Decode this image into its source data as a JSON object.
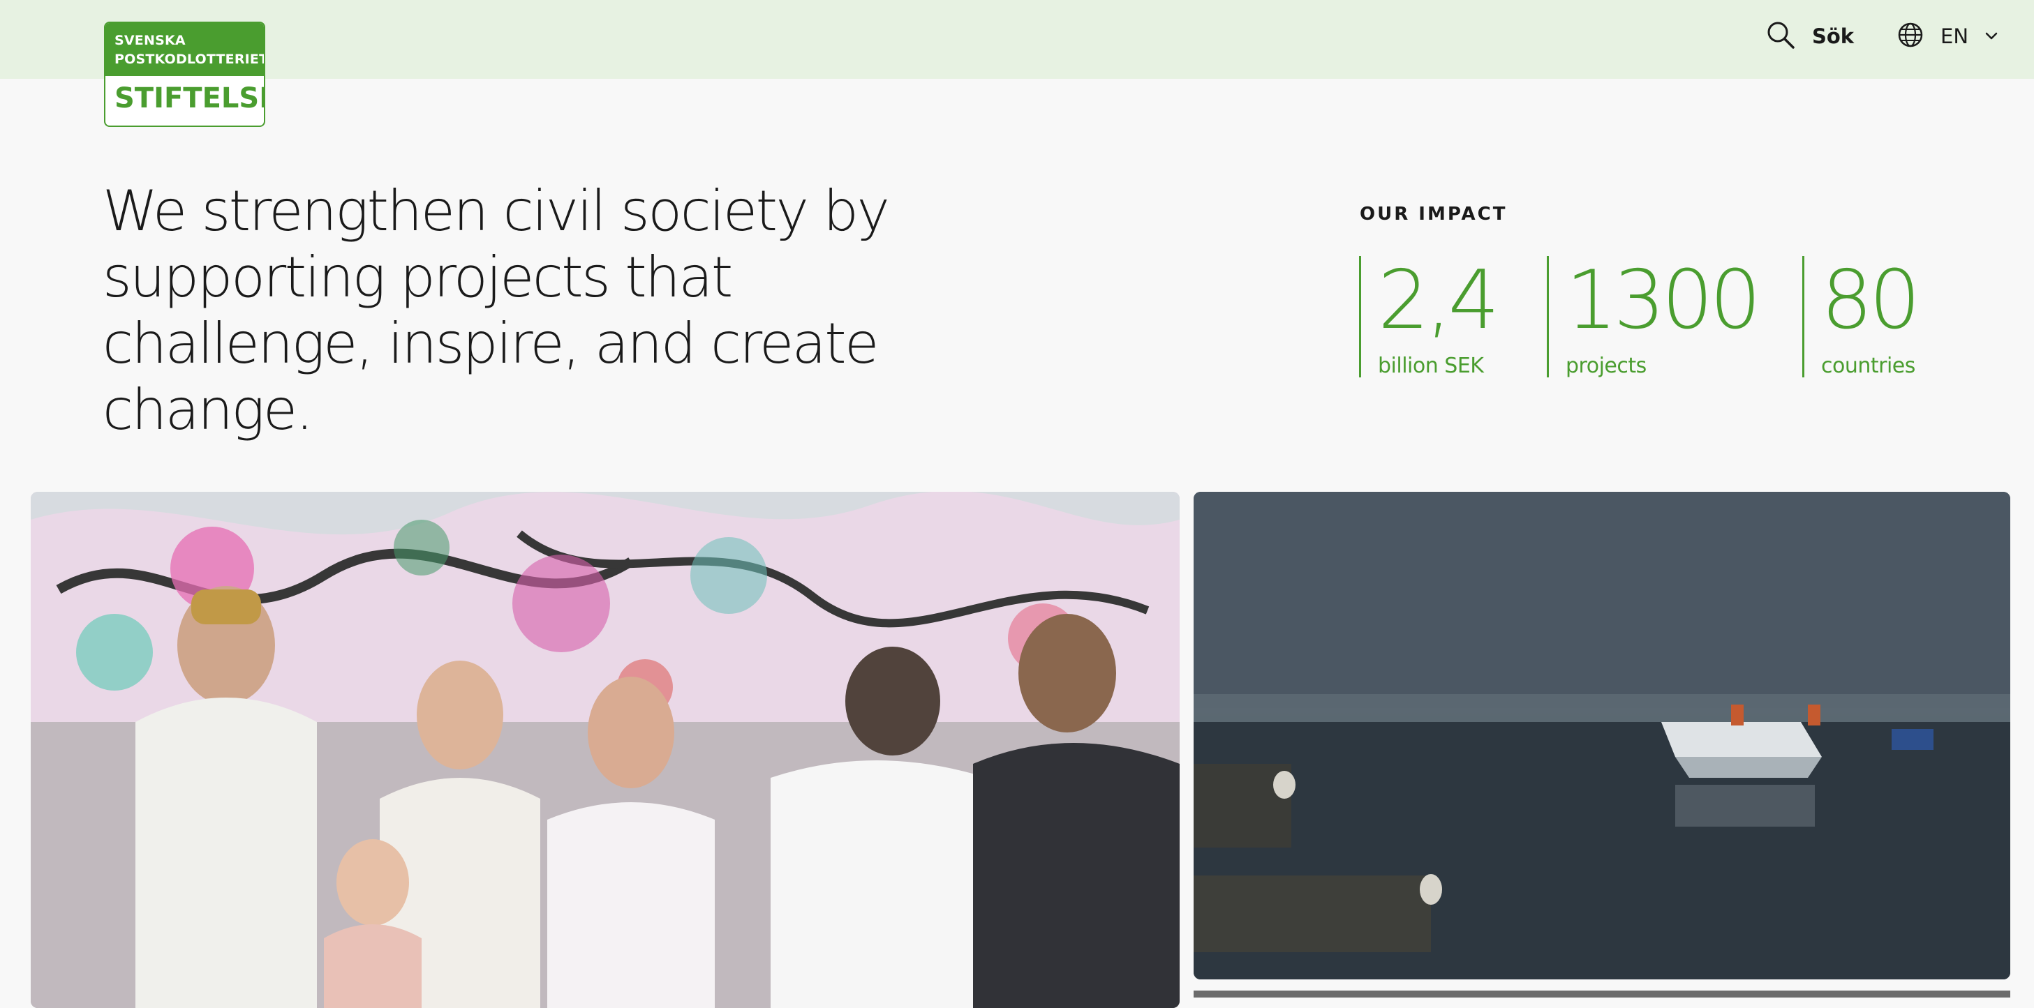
{
  "header": {
    "logo": {
      "line1": "SVENSKA",
      "line2": "POSTKODLOTTERIETS",
      "line3": "STIFTELSE"
    },
    "search_icon": "search-icon",
    "search_label": "Sök",
    "language_icon": "globe-icon",
    "language_label": "EN",
    "language_chevron": "chevron-down-icon"
  },
  "hero": {
    "headline": "We strengthen civil society by supporting projects that challenge, inspire, and create change."
  },
  "impact": {
    "title": "OUR IMPACT",
    "stats": [
      {
        "value": "2,4",
        "label": "billion SEK"
      },
      {
        "value": "1300",
        "label": "projects"
      },
      {
        "value": "80",
        "label": "countries"
      }
    ]
  },
  "images": {
    "left": {
      "subject": "group of young people in front of graffiti wall"
    },
    "right": {
      "subject": "small boat with two people on misty water near a pier"
    }
  },
  "colors": {
    "accent_green": "#4a9d2f",
    "header_background": "#e7f2e2",
    "page_background": "#f8f8f8",
    "text": "#1a1a1a"
  }
}
